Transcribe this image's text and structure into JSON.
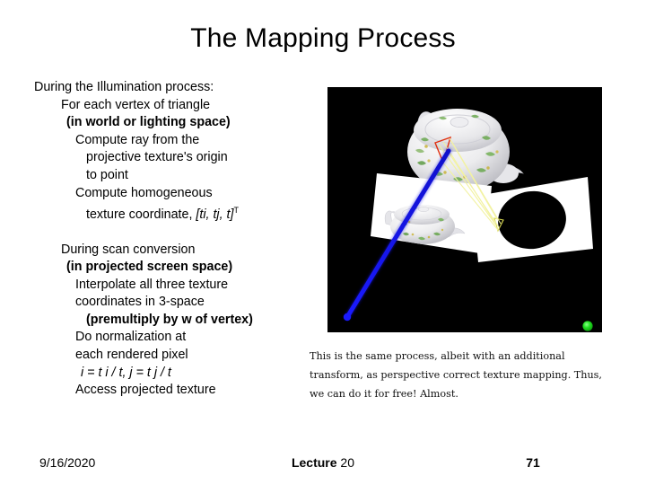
{
  "slide": {
    "title": "The Mapping Process"
  },
  "body": {
    "lines": [
      {
        "text": "During the Illumination process:",
        "indent": 0,
        "bold": false,
        "italic": false
      },
      {
        "text": "For each vertex of triangle",
        "indent": 1,
        "bold": false,
        "italic": false
      },
      {
        "text": "(in world or lighting space)",
        "indent": 2,
        "bold": true,
        "italic": false
      },
      {
        "text": "Compute ray from the",
        "indent": 3,
        "bold": false,
        "italic": false
      },
      {
        "text": "projective texture's origin",
        "indent": 4,
        "bold": false,
        "italic": false
      },
      {
        "text": "to point",
        "indent": 4,
        "bold": false,
        "italic": false
      },
      {
        "text": "Compute homogeneous",
        "indent": 3,
        "bold": false,
        "italic": false
      },
      {
        "text": "texture coordinate, ",
        "tail_italic": "[ti, tj, t]",
        "sup": "T",
        "indent": 4,
        "bold": false,
        "italic": false
      }
    ],
    "lines2": [
      {
        "text": "During scan conversion",
        "indent": 1,
        "bold": false,
        "italic": false
      },
      {
        "text": "(in projected screen space)",
        "indent": 2,
        "bold": true,
        "italic": false
      },
      {
        "text": "Interpolate all three texture",
        "indent": 3,
        "bold": false,
        "italic": false
      },
      {
        "text": "coordinates in 3-space",
        "indent": 3,
        "bold": false,
        "italic": false
      },
      {
        "text": "(premultiply by w of vertex)",
        "indent": 4,
        "bold": true,
        "italic": false
      },
      {
        "text": "Do normalization at",
        "indent": 3,
        "bold": false,
        "italic": false
      },
      {
        "text": "each rendered pixel",
        "indent": 3,
        "bold": false,
        "italic": false
      },
      {
        "text": "i = t i / t,      j = t j / t",
        "indent": 5,
        "bold": false,
        "italic": true
      },
      {
        "text": "Access projected texture",
        "indent": 3,
        "bold": false,
        "italic": false
      }
    ]
  },
  "caption": {
    "line1": "This is the same process, albeit with an additional",
    "line2": "transform, as perspective correct texture mapping. Thus,",
    "line3": "we can do it for free! Almost."
  },
  "render": {
    "alt": "3D render: white teapot with floral pattern on black background, two white projection quads, blue ray and yellow projector lines, green light marker",
    "background_color": "#000000",
    "ray_color": "#1414E6",
    "projector_line_color": "#F0F09A",
    "light_marker_color": "#22DD22",
    "quad_color": "#FFFFFF",
    "teapot_color": "#E8E8EA",
    "triangle_outline_color": "#E03010"
  },
  "footer": {
    "date": "9/16/2020",
    "lecture_bold": "Lecture",
    "lecture_num": " 20",
    "page": "71"
  }
}
